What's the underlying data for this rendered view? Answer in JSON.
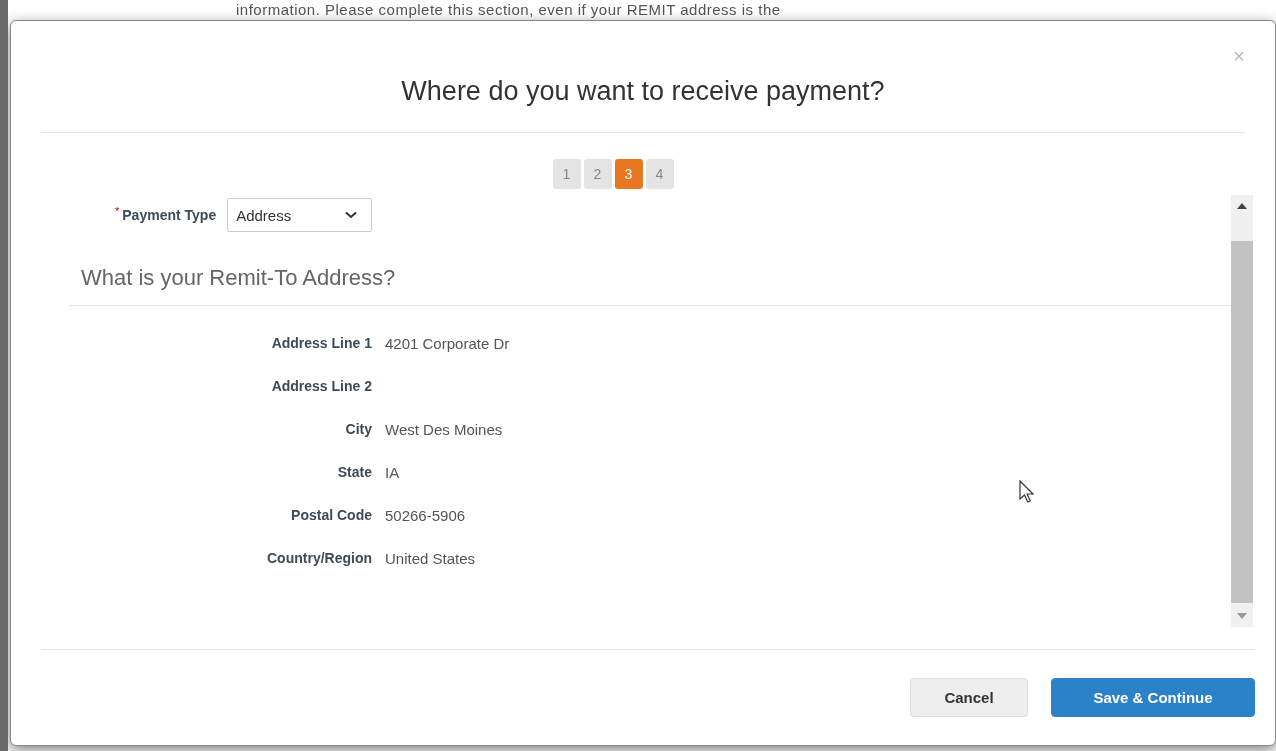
{
  "background_text": "information. Please complete this section, even if your REMIT address is the",
  "dialog": {
    "title": "Where do you want to receive payment?",
    "close": "×",
    "steps": [
      {
        "label": "1",
        "selected": false
      },
      {
        "label": "2",
        "selected": false
      },
      {
        "label": "3",
        "selected": true
      },
      {
        "label": "4",
        "selected": false
      }
    ],
    "payment_type": {
      "label": "Payment Type",
      "required_mark": "*",
      "value": "Address"
    },
    "section_heading": "What is your Remit-To Address?",
    "fields": [
      {
        "label": "Address Line 1",
        "value": "4201 Corporate Dr"
      },
      {
        "label": "Address Line 2"
      },
      {
        "label": "City",
        "value": "West Des Moines"
      },
      {
        "label": "State",
        "value": "IA"
      },
      {
        "label": "Postal Code",
        "value": "50266-5906"
      },
      {
        "label": "Country/Region",
        "value": "United States"
      }
    ],
    "buttons": [
      {
        "label": "Cancel",
        "kind": "secondary"
      },
      {
        "label": "Save & Continue",
        "kind": "primary"
      }
    ]
  }
}
